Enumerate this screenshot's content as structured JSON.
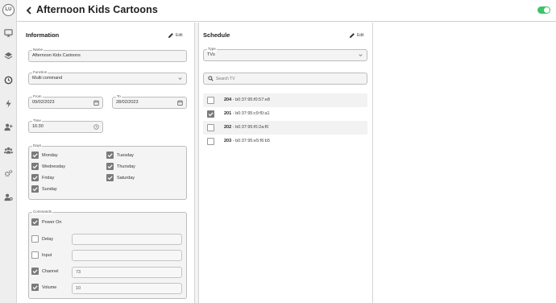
{
  "app": {
    "avatar_initials": "LU",
    "rail_icons": [
      "monitor-icon",
      "layers-icon",
      "clock-icon",
      "bolt-icon",
      "user-add-icon",
      "users-icon",
      "settings-icon",
      "user-gear-icon"
    ]
  },
  "header": {
    "title": "Afternoon Kids Cartoons",
    "enabled": true,
    "accent_color": "#3cc46a"
  },
  "info": {
    "title": "Information",
    "edit_label": "Edit",
    "name_label": "Name",
    "name_value": "Afternoon Kids Cartoons",
    "function_label": "Function",
    "function_value": "Multi command",
    "from_label": "From",
    "from_value": "09/02/2023",
    "to_label": "To",
    "to_value": "28/02/2023",
    "time_label": "Time",
    "time_value": "16:30",
    "days_label": "Days",
    "days": [
      {
        "label": "Monday",
        "checked": true
      },
      {
        "label": "Tuesday",
        "checked": true
      },
      {
        "label": "Wednesday",
        "checked": true
      },
      {
        "label": "Thursday",
        "checked": true
      },
      {
        "label": "Friday",
        "checked": true
      },
      {
        "label": "Saturday",
        "checked": true
      },
      {
        "label": "Sunday",
        "checked": true
      }
    ],
    "commands_label": "Commands",
    "commands": [
      {
        "label": "Power On",
        "checked": true,
        "value": null
      },
      {
        "label": "Delay",
        "checked": false,
        "value": ""
      },
      {
        "label": "Input",
        "checked": false,
        "value": ""
      },
      {
        "label": "Channel",
        "checked": true,
        "value": "73"
      },
      {
        "label": "Volume",
        "checked": true,
        "value": "10"
      }
    ]
  },
  "schedule": {
    "title": "Schedule",
    "edit_label": "Edit",
    "type_label": "Type",
    "type_value": "TVs",
    "search_placeholder": "Search TV",
    "tvs": [
      {
        "number": "204",
        "mac": "b0:37:95:f0:57:e8",
        "checked": false
      },
      {
        "number": "201",
        "mac": "b0:37:95:c9:f0:a1",
        "checked": true
      },
      {
        "number": "202",
        "mac": "b0:37:95:f0:2a:f0",
        "checked": false
      },
      {
        "number": "203",
        "mac": "b0:37:95:e5:f6:b5",
        "checked": false
      }
    ]
  }
}
